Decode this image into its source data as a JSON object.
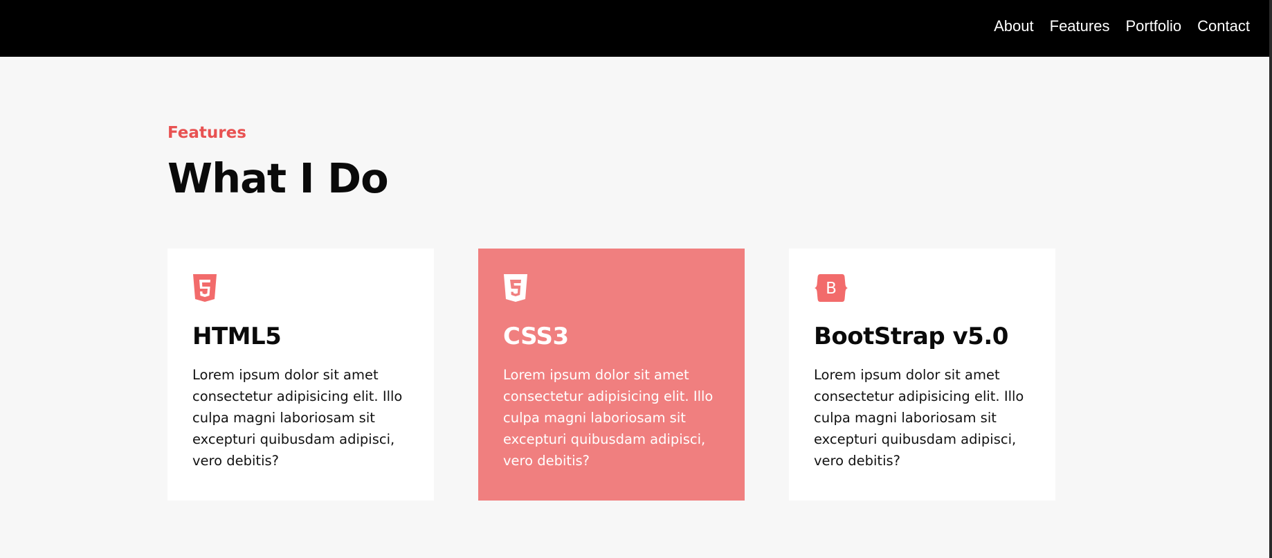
{
  "nav": {
    "links": [
      "About",
      "Features",
      "Portfolio",
      "Contact"
    ]
  },
  "section": {
    "eyebrow": "Features",
    "title": "What I Do"
  },
  "cards": [
    {
      "icon": "html5-icon",
      "title": "HTML5",
      "text": "Lorem ipsum dolor sit amet consectetur adipisicing elit. Illo culpa magni laboriosam sit excepturi quibusdam adipisci, vero debitis?"
    },
    {
      "icon": "css3-icon",
      "title": "CSS3",
      "text": "Lorem ipsum dolor sit amet consectetur adipisicing elit. Illo culpa magni laboriosam sit excepturi quibusdam adipisci, vero debitis?"
    },
    {
      "icon": "bootstrap-icon",
      "title": "BootStrap v5.0",
      "text": "Lorem ipsum dolor sit amet consectetur adipisicing elit. Illo culpa magni laboriosam sit excepturi quibusdam adipisci, vero debitis?"
    }
  ],
  "colors": {
    "accent": "#e85252",
    "highlight_card": "#f07f7f",
    "icon": "#f26b6b",
    "navbar": "#000000",
    "page_background": "#f7f7f7"
  }
}
